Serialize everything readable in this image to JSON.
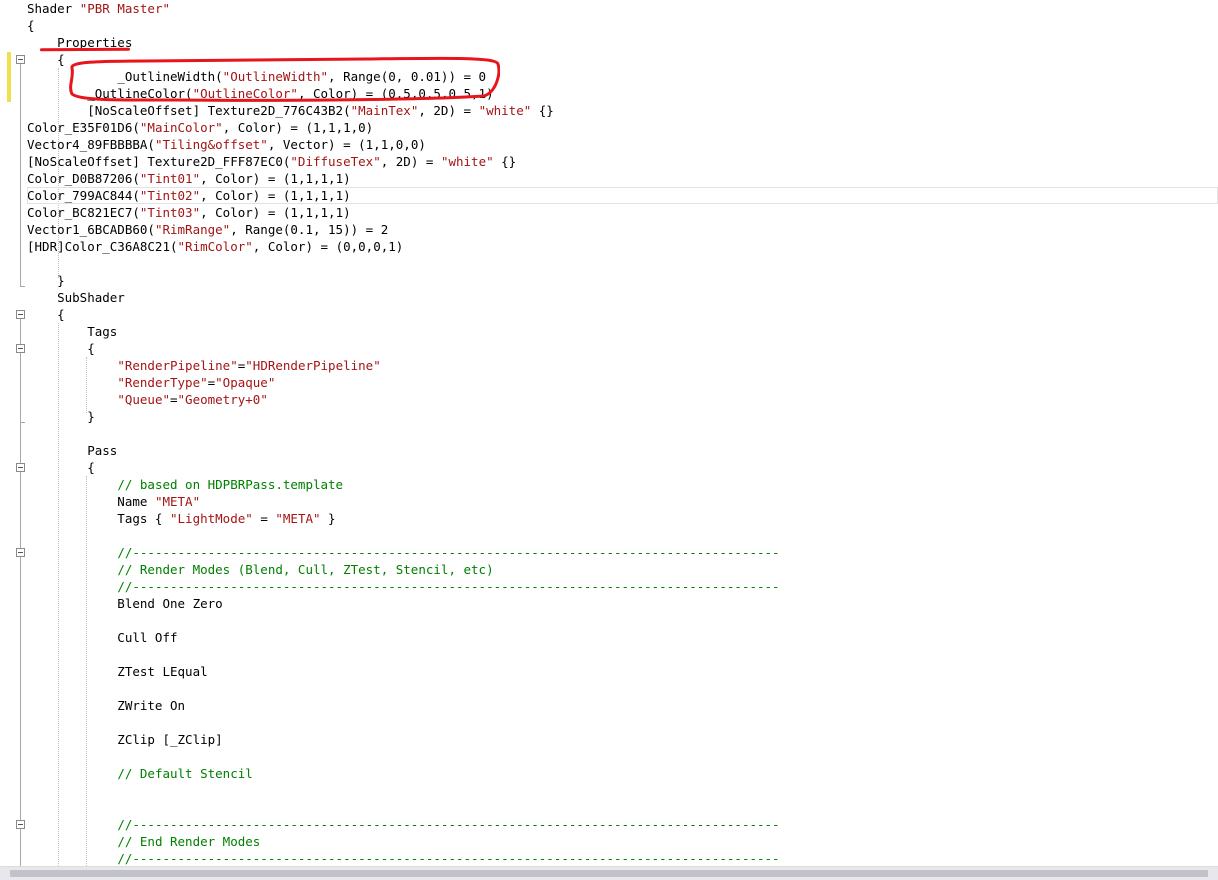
{
  "editor": {
    "code_lines": [
      [
        {
          "t": "Shader "
        },
        {
          "t": "\"PBR Master\"",
          "k": "s"
        }
      ],
      [
        {
          "t": "{"
        }
      ],
      [
        {
          "t": "    Properties"
        }
      ],
      [
        {
          "t": "    {"
        }
      ],
      [
        {
          "t": "            _OutlineWidth("
        },
        {
          "t": "\"OutlineWidth\"",
          "k": "s"
        },
        {
          "t": ", Range(0, 0.01)) = 0"
        }
      ],
      [
        {
          "t": "        _OutlineColor("
        },
        {
          "t": "\"OutlineColor\"",
          "k": "s"
        },
        {
          "t": ", Color) = (0.5,0.5,0.5,1)"
        }
      ],
      [
        {
          "t": "        [NoScaleOffset] Texture2D_776C43B2("
        },
        {
          "t": "\"MainTex\"",
          "k": "s"
        },
        {
          "t": ", 2D) = "
        },
        {
          "t": "\"white\"",
          "k": "s"
        },
        {
          "t": " {}"
        }
      ],
      [
        {
          "t": "Color_E35F01D6("
        },
        {
          "t": "\"MainColor\"",
          "k": "s"
        },
        {
          "t": ", Color) = (1,1,1,0)"
        }
      ],
      [
        {
          "t": "Vector4_89FBBBBA("
        },
        {
          "t": "\"Tiling&offset\"",
          "k": "s"
        },
        {
          "t": ", Vector) = (1,1,0,0)"
        }
      ],
      [
        {
          "t": "[NoScaleOffset] Texture2D_FFF87EC0("
        },
        {
          "t": "\"DiffuseTex\"",
          "k": "s"
        },
        {
          "t": ", 2D) = "
        },
        {
          "t": "\"white\"",
          "k": "s"
        },
        {
          "t": " {}"
        }
      ],
      [
        {
          "t": "Color_D0B87206("
        },
        {
          "t": "\"Tint01\"",
          "k": "s"
        },
        {
          "t": ", Color) = (1,1,1,1)"
        }
      ],
      [
        {
          "t": "Color_799AC844("
        },
        {
          "t": "\"Tint02\"",
          "k": "s"
        },
        {
          "t": ", Color) = (1,1,1,1)"
        }
      ],
      [
        {
          "t": "Color_BC821EC7("
        },
        {
          "t": "\"Tint03\"",
          "k": "s"
        },
        {
          "t": ", Color) = (1,1,1,1)"
        }
      ],
      [
        {
          "t": "Vector1_6BCADB60("
        },
        {
          "t": "\"RimRange\"",
          "k": "s"
        },
        {
          "t": ", Range(0.1, 15)) = 2"
        }
      ],
      [
        {
          "t": "[HDR]Color_C36A8C21("
        },
        {
          "t": "\"RimColor\"",
          "k": "s"
        },
        {
          "t": ", Color) = (0,0,0,1)"
        }
      ],
      [
        {
          "t": ""
        }
      ],
      [
        {
          "t": "    }"
        }
      ],
      [
        {
          "t": "    SubShader"
        }
      ],
      [
        {
          "t": "    {"
        }
      ],
      [
        {
          "t": "        Tags"
        }
      ],
      [
        {
          "t": "        {"
        }
      ],
      [
        {
          "t": "            "
        },
        {
          "t": "\"RenderPipeline\"",
          "k": "s"
        },
        {
          "t": "="
        },
        {
          "t": "\"HDRenderPipeline\"",
          "k": "s"
        }
      ],
      [
        {
          "t": "            "
        },
        {
          "t": "\"RenderType\"",
          "k": "s"
        },
        {
          "t": "="
        },
        {
          "t": "\"Opaque\"",
          "k": "s"
        }
      ],
      [
        {
          "t": "            "
        },
        {
          "t": "\"Queue\"",
          "k": "s"
        },
        {
          "t": "="
        },
        {
          "t": "\"Geometry+0\"",
          "k": "s"
        }
      ],
      [
        {
          "t": "        }"
        }
      ],
      [
        {
          "t": ""
        }
      ],
      [
        {
          "t": "        Pass"
        }
      ],
      [
        {
          "t": "        {"
        }
      ],
      [
        {
          "t": "            "
        },
        {
          "t": "// based on HDPBRPass.template",
          "k": "c"
        }
      ],
      [
        {
          "t": "            Name "
        },
        {
          "t": "\"META\"",
          "k": "s"
        }
      ],
      [
        {
          "t": "            Tags { "
        },
        {
          "t": "\"LightMode\"",
          "k": "s"
        },
        {
          "t": " = "
        },
        {
          "t": "\"META\"",
          "k": "s"
        },
        {
          "t": " }"
        }
      ],
      [
        {
          "t": ""
        }
      ],
      [
        {
          "t": "            "
        },
        {
          "t": "//--------------------------------------------------------------------------------------",
          "k": "c"
        }
      ],
      [
        {
          "t": "            "
        },
        {
          "t": "// Render Modes (Blend, Cull, ZTest, Stencil, etc)",
          "k": "c"
        }
      ],
      [
        {
          "t": "            "
        },
        {
          "t": "//--------------------------------------------------------------------------------------",
          "k": "c"
        }
      ],
      [
        {
          "t": "            Blend One Zero"
        }
      ],
      [
        {
          "t": ""
        }
      ],
      [
        {
          "t": "            Cull Off"
        }
      ],
      [
        {
          "t": ""
        }
      ],
      [
        {
          "t": "            ZTest LEqual"
        }
      ],
      [
        {
          "t": ""
        }
      ],
      [
        {
          "t": "            ZWrite On"
        }
      ],
      [
        {
          "t": ""
        }
      ],
      [
        {
          "t": "            ZClip [_ZClip]"
        }
      ],
      [
        {
          "t": ""
        }
      ],
      [
        {
          "t": "            "
        },
        {
          "t": "// Default Stencil",
          "k": "c"
        }
      ],
      [
        {
          "t": ""
        }
      ],
      [
        {
          "t": ""
        }
      ],
      [
        {
          "t": "            "
        },
        {
          "t": "//--------------------------------------------------------------------------------------",
          "k": "c"
        }
      ],
      [
        {
          "t": "            "
        },
        {
          "t": "// End Render Modes",
          "k": "c"
        }
      ],
      [
        {
          "t": "            "
        },
        {
          "t": "//--------------------------------------------------------------------------------------",
          "k": "c"
        }
      ]
    ],
    "current_line_index": 11,
    "colors": {
      "string": "#a31515",
      "comment": "#008000",
      "annotation": "#e8161c",
      "change_marker": "#f1e04c"
    },
    "icons": {
      "fold": "collapse-minus-icon"
    }
  }
}
